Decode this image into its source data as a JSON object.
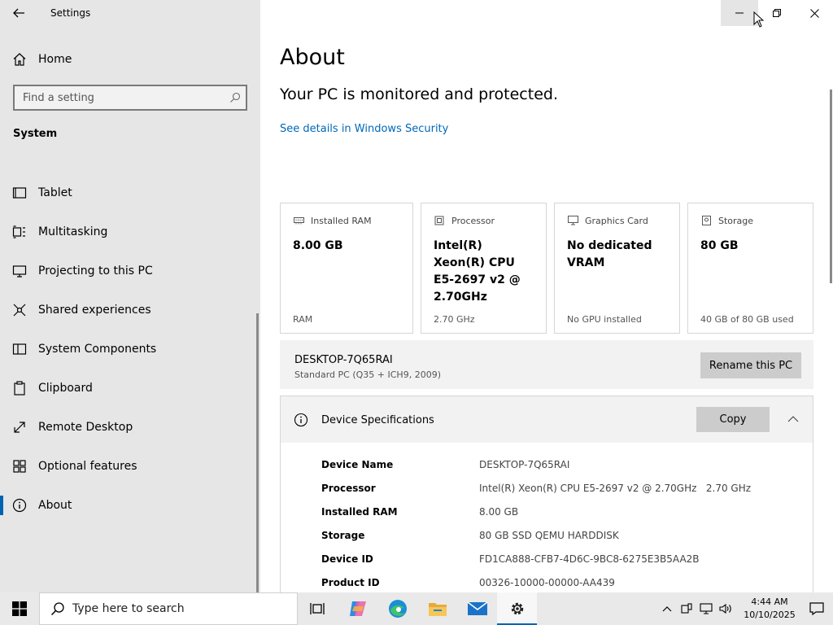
{
  "window": {
    "title": "Settings"
  },
  "sidebar": {
    "home_label": "Home",
    "search_placeholder": "Find a setting",
    "section_title": "System",
    "items": [
      {
        "label": "Tablet",
        "icon": "tablet-icon"
      },
      {
        "label": "Multitasking",
        "icon": "multitasking-icon"
      },
      {
        "label": "Projecting to this PC",
        "icon": "projecting-icon"
      },
      {
        "label": "Shared experiences",
        "icon": "shared-experiences-icon"
      },
      {
        "label": "System Components",
        "icon": "system-components-icon"
      },
      {
        "label": "Clipboard",
        "icon": "clipboard-icon"
      },
      {
        "label": "Remote Desktop",
        "icon": "remote-desktop-icon"
      },
      {
        "label": "Optional features",
        "icon": "optional-features-icon"
      },
      {
        "label": "About",
        "icon": "info-icon",
        "active": true
      }
    ]
  },
  "main": {
    "title": "About",
    "protected_text": "Your PC is monitored and protected.",
    "security_link": "See details in Windows Security",
    "cards": [
      {
        "label": "Installed RAM",
        "value": "8.00 GB",
        "sub": "RAM",
        "icon": "ram-icon"
      },
      {
        "label": "Processor",
        "value": "Intel(R) Xeon(R) CPU E5-2697 v2 @ 2.70GHz",
        "sub": "2.70 GHz",
        "icon": "processor-icon"
      },
      {
        "label": "Graphics Card",
        "value": "No dedicated VRAM",
        "sub": "No GPU installed",
        "icon": "graphics-card-icon"
      },
      {
        "label": "Storage",
        "value": "80 GB",
        "sub": "40 GB of 80 GB used",
        "icon": "storage-icon"
      }
    ],
    "pc": {
      "name": "DESKTOP-7Q65RAI",
      "model": "Standard PC (Q35 + ICH9, 2009)",
      "rename_label": "Rename this PC"
    },
    "specs": {
      "title": "Device Specifications",
      "copy_label": "Copy",
      "rows": [
        {
          "key": "Device Name",
          "value": "DESKTOP-7Q65RAI"
        },
        {
          "key": "Processor",
          "value": "Intel(R) Xeon(R) CPU E5-2697 v2 @ 2.70GHz   2.70 GHz"
        },
        {
          "key": "Installed RAM",
          "value": "8.00 GB"
        },
        {
          "key": "Storage",
          "value": "80 GB SSD QEMU HARDDISK"
        },
        {
          "key": "Device ID",
          "value": "FD1CA888-CFB7-4D6C-9BC8-6275E3B5AA2B"
        },
        {
          "key": "Product ID",
          "value": "00326-10000-00000-AA439"
        }
      ]
    }
  },
  "taskbar": {
    "search_placeholder": "Type here to search",
    "time": "4:44 AM",
    "date": "10/10/2025"
  },
  "colors": {
    "accent": "#0063b1",
    "link": "#0067b8",
    "sidebar_bg": "#e6e6e6",
    "button_bg": "#cccccc"
  }
}
